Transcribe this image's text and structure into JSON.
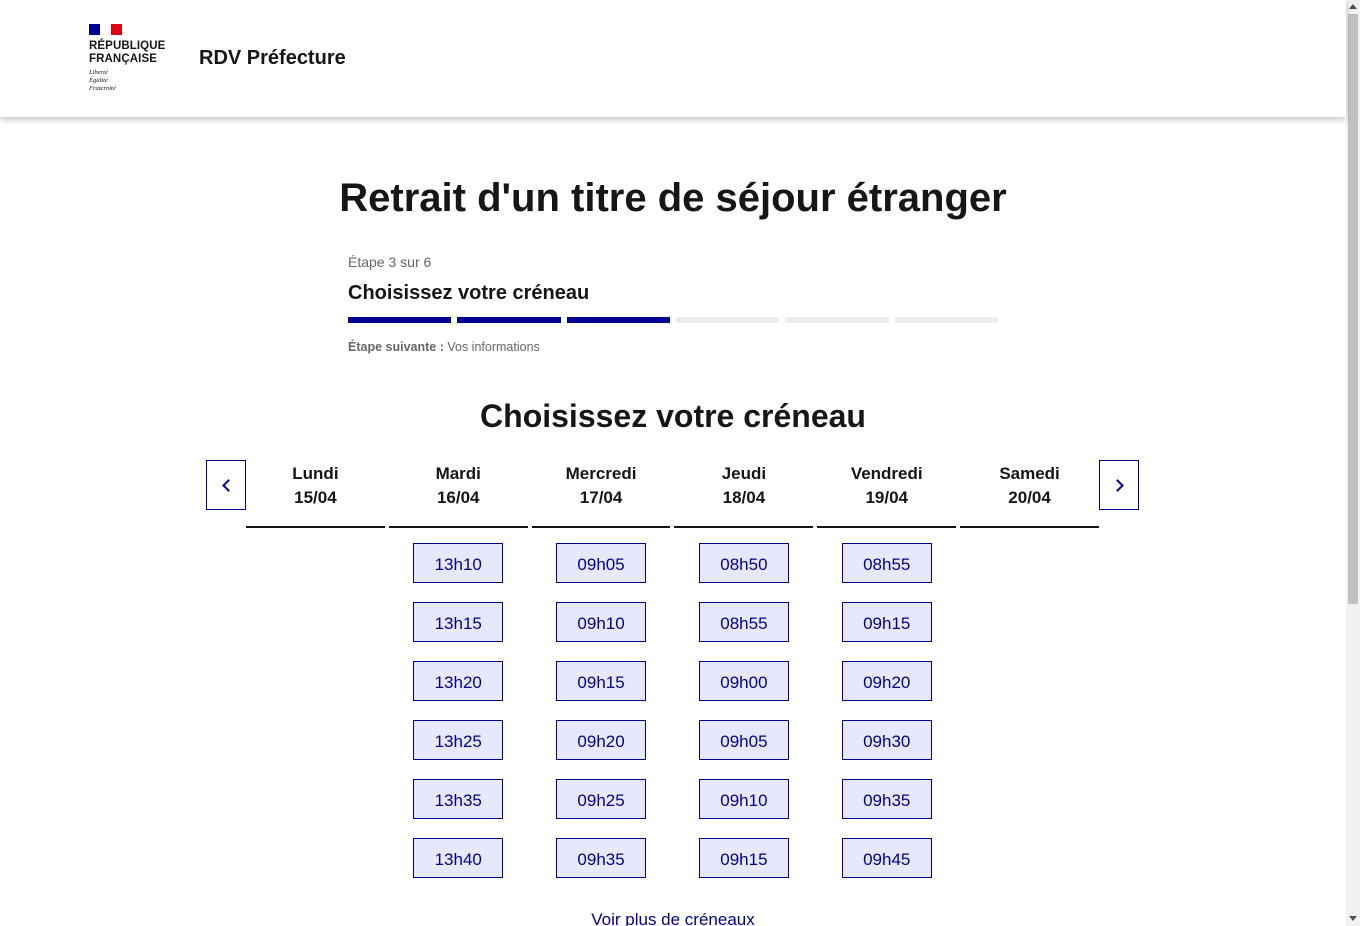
{
  "header": {
    "logo_line1": "RÉPUBLIQUE",
    "logo_line2": "FRANÇAISE",
    "motto_line1": "Liberté",
    "motto_line2": "Égalité",
    "motto_line3": "Fraternité",
    "service_title": "RDV Préfecture"
  },
  "page": {
    "title": "Retrait d'un titre de séjour étranger"
  },
  "stepper": {
    "state": "Étape 3 sur 6",
    "title": "Choisissez votre créneau",
    "current": 3,
    "total": 6,
    "next_label": "Étape suivante :",
    "next_value": "Vos informations"
  },
  "calendar": {
    "title": "Choisissez votre créneau",
    "prev_icon": "chevron-left-icon",
    "next_icon": "chevron-right-icon",
    "days": [
      {
        "name": "Lundi",
        "date": "15/04",
        "slots": []
      },
      {
        "name": "Mardi",
        "date": "16/04",
        "slots": [
          "13h10",
          "13h15",
          "13h20",
          "13h25",
          "13h35",
          "13h40"
        ]
      },
      {
        "name": "Mercredi",
        "date": "17/04",
        "slots": [
          "09h05",
          "09h10",
          "09h15",
          "09h20",
          "09h25",
          "09h35"
        ]
      },
      {
        "name": "Jeudi",
        "date": "18/04",
        "slots": [
          "08h50",
          "08h55",
          "09h00",
          "09h05",
          "09h10",
          "09h15"
        ]
      },
      {
        "name": "Vendredi",
        "date": "19/04",
        "slots": [
          "08h55",
          "09h15",
          "09h20",
          "09h30",
          "09h35",
          "09h45"
        ]
      },
      {
        "name": "Samedi",
        "date": "20/04",
        "slots": []
      }
    ],
    "more_link": "Voir plus de créneaux"
  },
  "colors": {
    "primary": "#000091",
    "slot_bg": "#e8e8fd",
    "flag_red": "#e1000f",
    "text": "#161616",
    "muted": "#666666"
  }
}
